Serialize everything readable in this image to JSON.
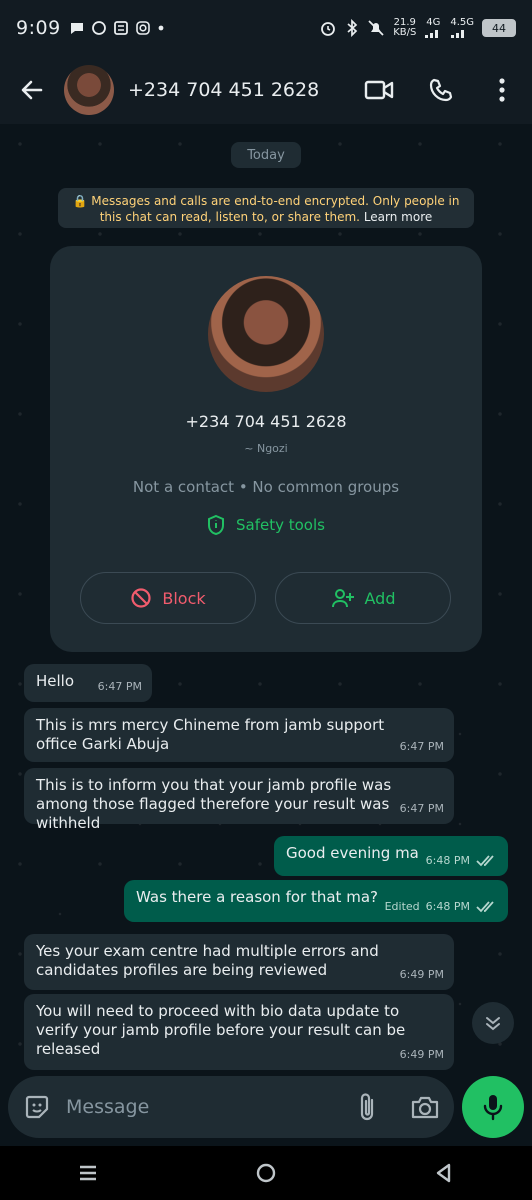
{
  "status_bar": {
    "time": "9:09",
    "speed_value": "21.9",
    "speed_unit": "KB/S",
    "net1": "4G",
    "net2": "4.5G",
    "battery": "44"
  },
  "header": {
    "contact_name": "+234 704 451 2628"
  },
  "chat": {
    "date_chip": "Today",
    "encryption_note": "Messages and calls are end-to-end encrypted. Only people in this chat can read, listen to, or share them.",
    "encryption_link": "Learn more",
    "card": {
      "phone": "+234 704 451 2628",
      "push_name": "~ Ngozi",
      "info": "Not a contact • No common groups",
      "safety_label": "Safety tools",
      "block_label": "Block",
      "add_label": "Add"
    },
    "messages": [
      {
        "text": "Hello",
        "time": "6:47 PM"
      },
      {
        "text": "This is mrs mercy Chineme from jamb support office Garki Abuja",
        "time": "6:47 PM"
      },
      {
        "text": "This is to inform you that your jamb profile was among those flagged therefore your result was withheld",
        "time": "6:47 PM"
      },
      {
        "text": "Good evening ma",
        "time": "6:48 PM"
      },
      {
        "text": "Was there a reason for that ma?",
        "time": "6:48 PM",
        "edited": "Edited"
      },
      {
        "text": "Yes your exam centre had multiple errors and candidates profiles are being reviewed",
        "time": "6:49 PM"
      },
      {
        "text": "You will need to proceed with bio data update to verify your jamb profile before your result can be released",
        "time": "6:49 PM"
      }
    ]
  },
  "composer": {
    "placeholder": "Message"
  },
  "colors": {
    "background": "#0b141a",
    "incoming": "#1f2c33",
    "outgoing": "#005c4b",
    "accent": "#21c063",
    "danger": "#f15c6d"
  },
  "icons": [
    "back-arrow-icon",
    "video-call-icon",
    "phone-icon",
    "more-icon",
    "shield-icon",
    "block-icon",
    "add-person-icon",
    "double-check-icon",
    "chevron-down-icon",
    "sticker-icon",
    "attach-icon",
    "camera-icon",
    "mic-icon"
  ]
}
